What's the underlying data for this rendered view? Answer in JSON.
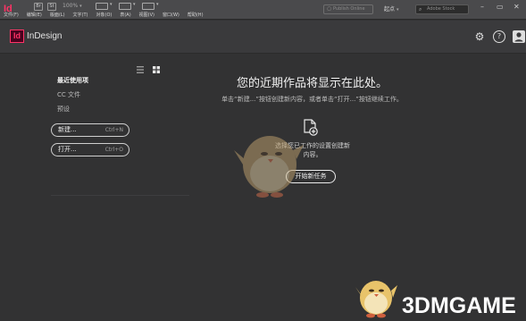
{
  "menubar": {
    "app_icon": "Id",
    "br_label": "Br",
    "st_label": "St",
    "zoom": "100%",
    "menus": [
      "文件(F)",
      "编辑(E)",
      "版面(L)",
      "文字(T)",
      "对象(O)",
      "表(A)",
      "视图(V)",
      "窗口(W)",
      "帮助(H)"
    ],
    "publish_label": "Publish Online",
    "workspace_label": "起点",
    "search_placeholder": "Adobe Stock"
  },
  "header": {
    "badge": "Id",
    "title": "InDesign"
  },
  "sidebar": {
    "items": [
      {
        "label": "最近使用项",
        "active": true
      },
      {
        "label": "CC 文件",
        "active": false
      },
      {
        "label": "预设",
        "active": false
      }
    ],
    "new_button": {
      "label": "新建...",
      "shortcut": "Ctrl+N"
    },
    "open_button": {
      "label": "打开...",
      "shortcut": "Ctrl+O"
    }
  },
  "main": {
    "heading": "您的近期作品将显示在此处。",
    "subtext": "单击“新建...”按钮创建新内容，或者单击“打开...”按钮继续工作。",
    "hint": "选择您已工作的设置创建新内容。",
    "start_button": "开始新任务"
  },
  "watermark": {
    "text": "3DMGAME"
  },
  "colors": {
    "accent": "#ff3366",
    "background": "#323233",
    "menubar": "#4a4a4c"
  }
}
